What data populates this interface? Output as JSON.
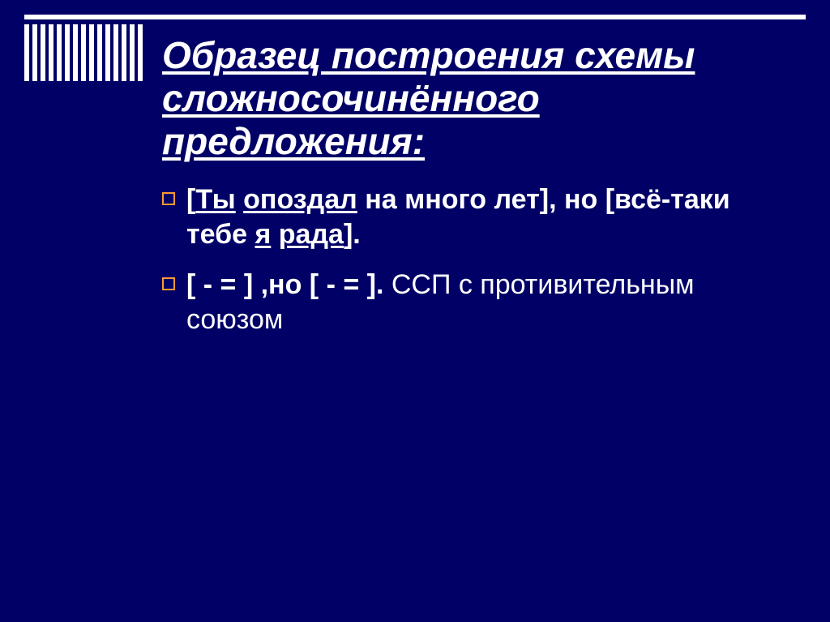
{
  "title": "Образец  построения схемы сложносочинённого предложения:",
  "bullets": [
    {
      "parts": [
        {
          "text": "[",
          "bold": true,
          "underline": false
        },
        {
          "text": "Ты",
          "bold": true,
          "underline": true
        },
        {
          "text": " ",
          "bold": true,
          "underline": false
        },
        {
          "text": "опоздал",
          "bold": true,
          "underline": true
        },
        {
          "text": " на много лет], но [всё-таки тебе ",
          "bold": true,
          "underline": false
        },
        {
          "text": "я",
          "bold": true,
          "underline": true
        },
        {
          "text": " ",
          "bold": true,
          "underline": false
        },
        {
          "text": "рада",
          "bold": true,
          "underline": true
        },
        {
          "text": "].",
          "bold": true,
          "underline": false
        }
      ]
    },
    {
      "parts": [
        {
          "text": "[ - =   ] ,но [ - =   ].",
          "bold": true,
          "underline": false
        },
        {
          "text": " ССП с противительным союзом",
          "bold": false,
          "underline": false
        }
      ]
    }
  ]
}
